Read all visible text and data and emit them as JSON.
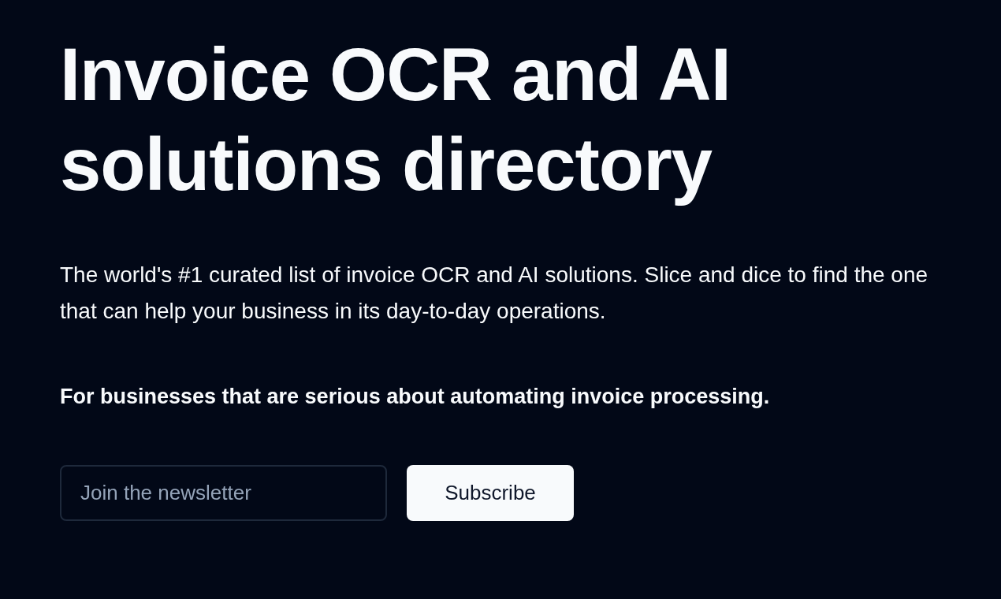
{
  "hero": {
    "title": "Invoice OCR and AI solutions directory",
    "description": "The world's #1 curated list of invoice OCR and AI solutions. Slice and dice to find the one that can help your business in its day-to-day operations.",
    "tagline": "For businesses that are serious about automating invoice processing."
  },
  "newsletter": {
    "placeholder": "Join the newsletter",
    "button": "Subscribe"
  }
}
